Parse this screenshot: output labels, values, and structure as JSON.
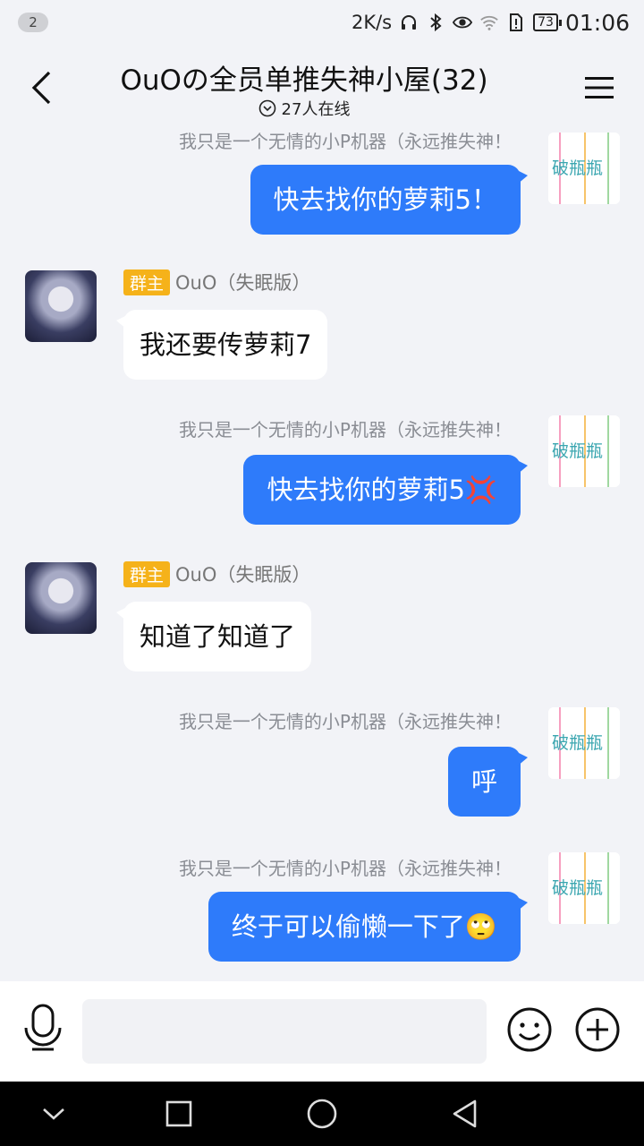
{
  "status_bar": {
    "notification_count": "2",
    "network_speed": "2K/s",
    "battery": "73",
    "time": "01:06"
  },
  "header": {
    "title": "OuOの全员单推失神小屋(32)",
    "online": "27人在线"
  },
  "messages": [
    {
      "side": "right",
      "sender": "我只是一个无情的小P机器（永远推失神！",
      "text": "快去找你的萝莉5！"
    },
    {
      "side": "left",
      "badge": "群主",
      "sender": "OuO（失眠版）",
      "text": "我还要传萝莉7"
    },
    {
      "side": "right",
      "sender": "我只是一个无情的小P机器（永远推失神！",
      "text": "快去找你的萝莉5💢"
    },
    {
      "side": "left",
      "badge": "群主",
      "sender": "OuO（失眠版）",
      "text": "知道了知道了"
    },
    {
      "side": "right",
      "sender": "我只是一个无情的小P机器（永远推失神！",
      "text": "呼"
    },
    {
      "side": "right",
      "sender": "我只是一个无情的小P机器（永远推失神！",
      "text": "终于可以偷懒一下了🙄"
    }
  ],
  "avatar_right_text": "破瓶瓶",
  "input": {
    "placeholder": ""
  },
  "icons": [
    "back-icon",
    "menu-icon",
    "chevron-circle-icon",
    "mic-icon",
    "emoji-icon",
    "plus-icon",
    "nav-back-icon",
    "nav-home-icon",
    "nav-recents-icon",
    "nav-down-icon"
  ],
  "colors": {
    "accent": "#2e7bfa",
    "badge": "#f5b21a",
    "background": "#f2f3f7"
  }
}
